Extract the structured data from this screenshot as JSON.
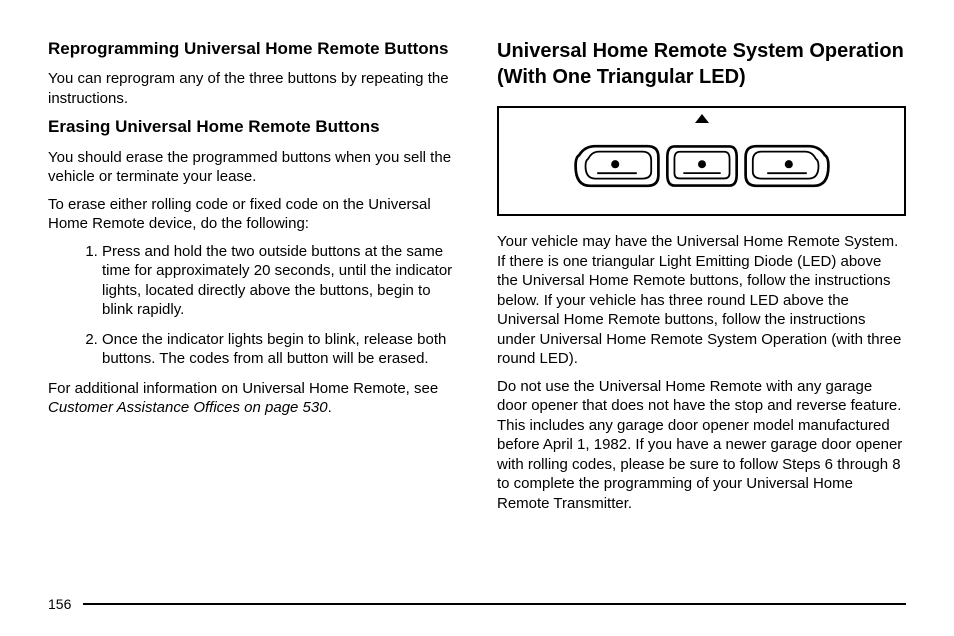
{
  "left": {
    "h2a": "Reprogramming Universal Home Remote Buttons",
    "p1": "You can reprogram any of the three buttons by repeating the instructions.",
    "h2b": "Erasing Universal Home Remote Buttons",
    "p2": "You should erase the programmed buttons when you sell the vehicle or terminate your lease.",
    "p3": "To erase either rolling code or fixed code on the Universal Home Remote device, do the following:",
    "li1": "Press and hold the two outside buttons at the same time for approximately 20 seconds, until the indicator lights, located directly above the buttons, begin to blink rapidly.",
    "li2": "Once the indicator lights begin to blink, release both buttons. The codes from all button will be erased.",
    "p4a": "For additional information on Universal Home Remote, see ",
    "p4b": "Customer Assistance Offices on page 530",
    "p4c": "."
  },
  "right": {
    "h3": "Universal Home Remote System Operation (With One Triangular LED)",
    "p1": "Your vehicle may have the Universal Home Remote System. If there is one triangular Light Emitting Diode (LED) above the Universal Home Remote buttons, follow the instructions below. If your vehicle has three round LED above the Universal Home Remote buttons, follow the instructions under Universal Home Remote System Operation (with three round LED).",
    "p2": "Do not use the Universal Home Remote with any garage door opener that does not have the stop and reverse feature. This includes any garage door opener model manufactured before April 1, 1982. If you have a newer garage door opener with rolling codes, please be sure to follow Steps 6 through 8 to complete the programming of your Universal Home Remote Transmitter."
  },
  "pageNumber": "156"
}
